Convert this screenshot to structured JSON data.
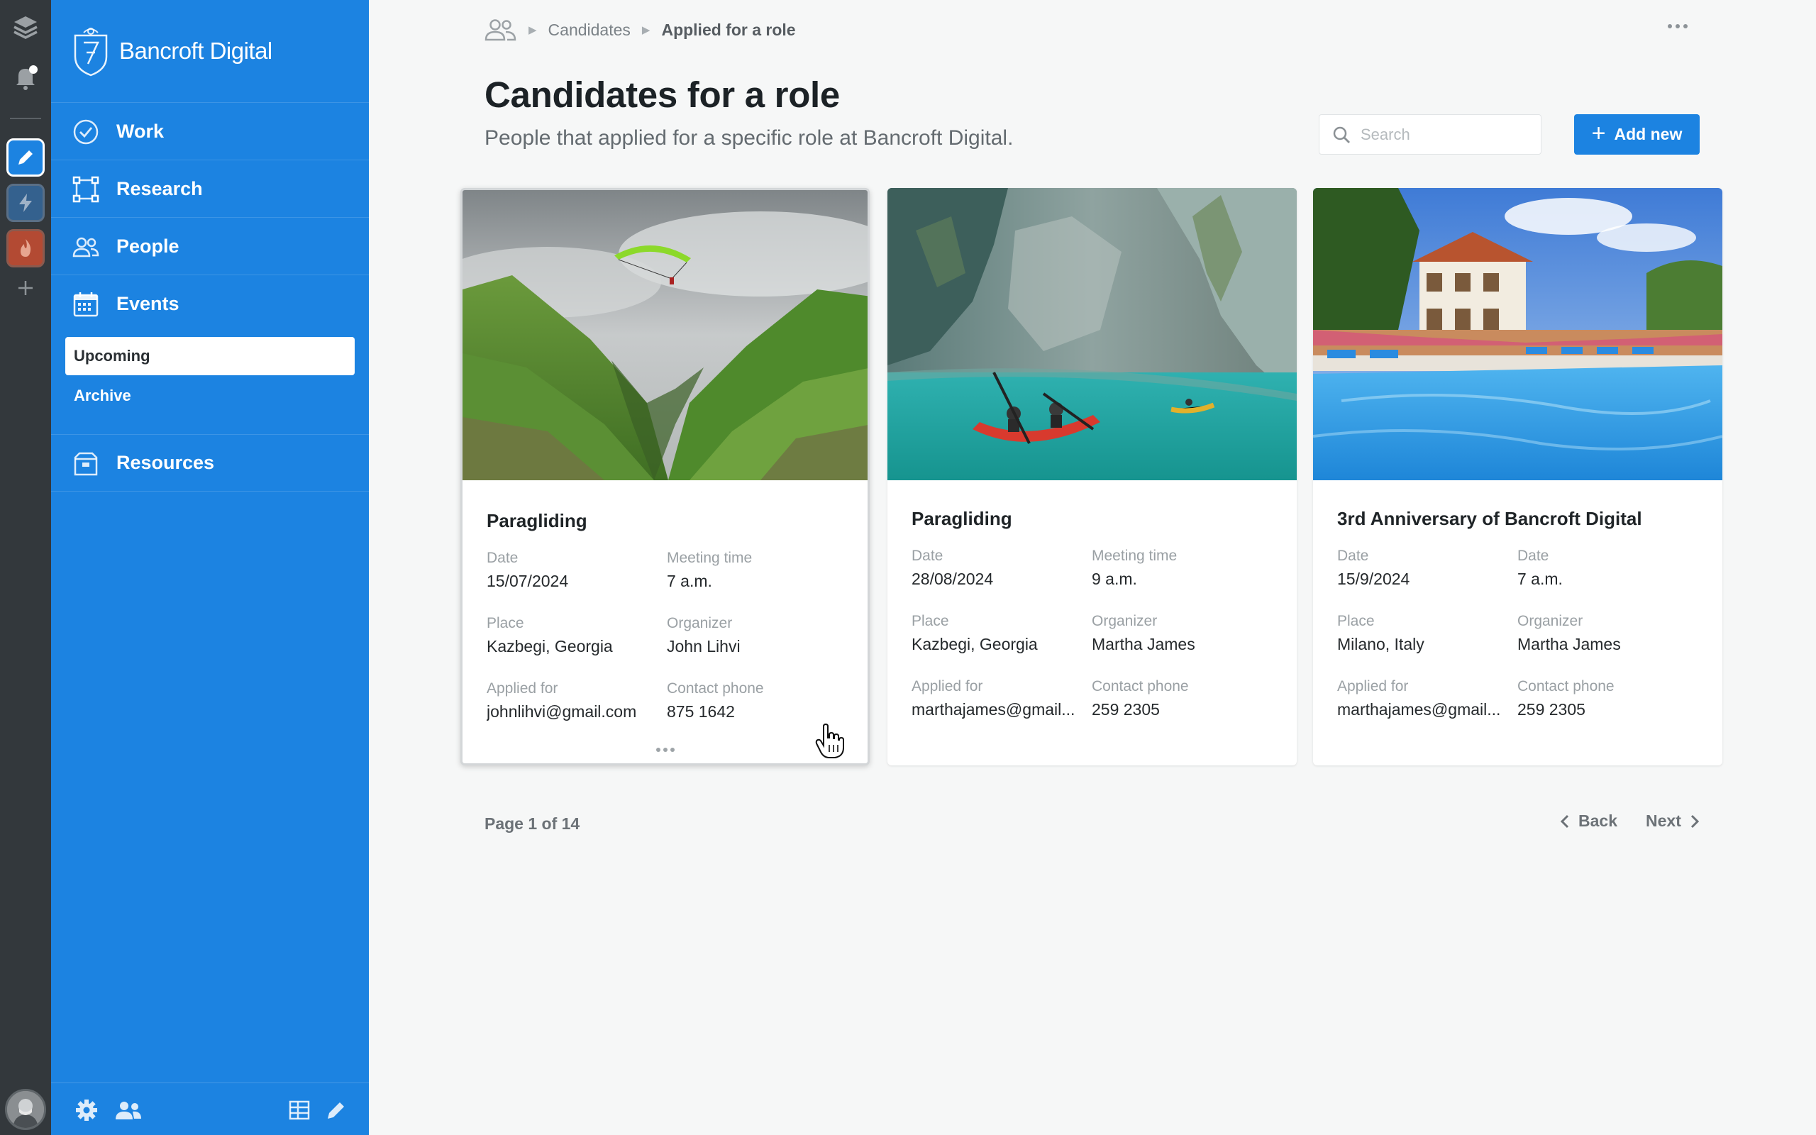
{
  "brand": {
    "name": "Bancroft Digital"
  },
  "nav": {
    "items": [
      {
        "label": "Work",
        "icon": "check-circle-icon"
      },
      {
        "label": "Research",
        "icon": "frame-icon"
      },
      {
        "label": "People",
        "icon": "people-icon"
      },
      {
        "label": "Events",
        "icon": "calendar-icon"
      },
      {
        "label": "Resources",
        "icon": "box-icon"
      }
    ],
    "events_sub": [
      {
        "label": "Upcoming",
        "active": true
      },
      {
        "label": "Archive",
        "active": false
      }
    ]
  },
  "breadcrumb": {
    "icon": "people-icon",
    "items": [
      "Candidates",
      "Applied for a role"
    ]
  },
  "header": {
    "title": "Candidates for a role",
    "subtitle": "People that applied for a specific role at Bancroft Digital."
  },
  "search": {
    "placeholder": "Search",
    "value": ""
  },
  "add_button": {
    "label": "Add new"
  },
  "cards": [
    {
      "title": "Paragliding",
      "image": "mountain-valley-paraglider",
      "fields": [
        {
          "label": "Date",
          "value": "15/07/2024"
        },
        {
          "label": "Meeting time",
          "value": "7 a.m."
        },
        {
          "label": "Place",
          "value": "Kazbegi, Georgia"
        },
        {
          "label": "Organizer",
          "value": "John Lihvi"
        },
        {
          "label": "Applied for",
          "value": "johnlihvi@gmail.com"
        },
        {
          "label": "Contact phone",
          "value": "875 1642"
        }
      ]
    },
    {
      "title": "Paragliding",
      "image": "kayak-cliffs-turquoise-water",
      "fields": [
        {
          "label": "Date",
          "value": "28/08/2024"
        },
        {
          "label": "Meeting time",
          "value": "9 a.m."
        },
        {
          "label": "Place",
          "value": "Kazbegi, Georgia"
        },
        {
          "label": "Organizer",
          "value": "Martha James"
        },
        {
          "label": "Applied for",
          "value": "marthajames@gmail..."
        },
        {
          "label": "Contact phone",
          "value": "259 2305"
        }
      ]
    },
    {
      "title": "3rd Anniversary of Bancroft Digital",
      "image": "villa-swimming-pool",
      "fields": [
        {
          "label": "Date",
          "value": "15/9/2024"
        },
        {
          "label": "Date",
          "value": "7 a.m."
        },
        {
          "label": "Place",
          "value": "Milano, Italy"
        },
        {
          "label": "Organizer",
          "value": "Martha James"
        },
        {
          "label": "Applied for",
          "value": "marthajames@gmail..."
        },
        {
          "label": "Contact phone",
          "value": "259 2305"
        }
      ]
    }
  ],
  "pagination": {
    "text": "Page 1 of 14",
    "back": "Back",
    "next": "Next"
  },
  "colors": {
    "rail": "#33383c",
    "sidebar": "#1c83e1",
    "accent": "#1c83e1",
    "background": "#f6f7f7"
  }
}
